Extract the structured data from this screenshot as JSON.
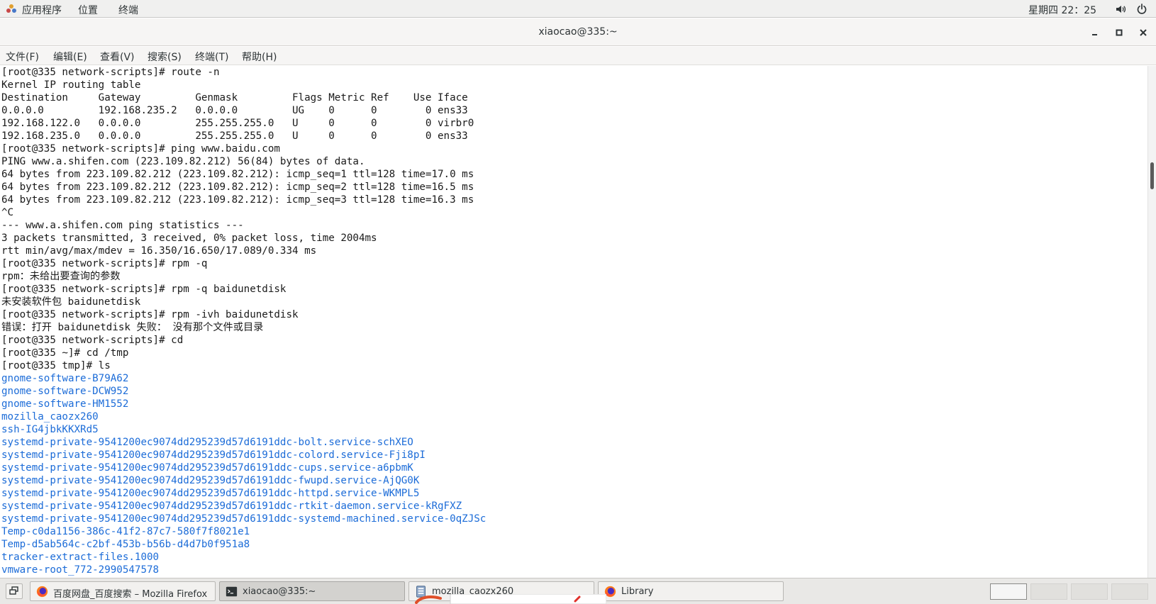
{
  "topbar": {
    "menus": [
      "应用程序",
      "位置",
      "终端"
    ],
    "clock": "星期四 22：25",
    "icons": [
      "volume-icon",
      "power-icon"
    ]
  },
  "window": {
    "title": "xiaocao@335:~",
    "controls": [
      "minimize-icon",
      "maximize-icon",
      "close-icon"
    ]
  },
  "menubar": {
    "items": [
      "文件(F)",
      "编辑(E)",
      "查看(V)",
      "搜索(S)",
      "终端(T)",
      "帮助(H)"
    ]
  },
  "terminal": {
    "lines": [
      {
        "text": "[root@335 network-scripts]# route -n",
        "type": "text"
      },
      {
        "text": "Kernel IP routing table",
        "type": "text"
      },
      {
        "text": "Destination     Gateway         Genmask         Flags Metric Ref    Use Iface",
        "type": "text"
      },
      {
        "text": "0.0.0.0         192.168.235.2   0.0.0.0         UG    0      0        0 ens33",
        "type": "text"
      },
      {
        "text": "192.168.122.0   0.0.0.0         255.255.255.0   U     0      0        0 virbr0",
        "type": "text"
      },
      {
        "text": "192.168.235.0   0.0.0.0         255.255.255.0   U     0      0        0 ens33",
        "type": "text"
      },
      {
        "text": "[root@335 network-scripts]# ping www.baidu.com",
        "type": "text"
      },
      {
        "text": "PING www.a.shifen.com (223.109.82.212) 56(84) bytes of data.",
        "type": "text"
      },
      {
        "text": "64 bytes from 223.109.82.212 (223.109.82.212): icmp_seq=1 ttl=128 time=17.0 ms",
        "type": "text"
      },
      {
        "text": "64 bytes from 223.109.82.212 (223.109.82.212): icmp_seq=2 ttl=128 time=16.5 ms",
        "type": "text"
      },
      {
        "text": "64 bytes from 223.109.82.212 (223.109.82.212): icmp_seq=3 ttl=128 time=16.3 ms",
        "type": "text"
      },
      {
        "text": "^C",
        "type": "text"
      },
      {
        "text": "--- www.a.shifen.com ping statistics ---",
        "type": "text"
      },
      {
        "text": "3 packets transmitted, 3 received, 0% packet loss, time 2004ms",
        "type": "text"
      },
      {
        "text": "rtt min/avg/max/mdev = 16.350/16.650/17.089/0.334 ms",
        "type": "text"
      },
      {
        "text": "[root@335 network-scripts]# rpm -q",
        "type": "text"
      },
      {
        "text": "rpm：未给出要查询的参数",
        "type": "text"
      },
      {
        "text": "[root@335 network-scripts]# rpm -q baidunetdisk",
        "type": "text"
      },
      {
        "text": "未安装软件包 baidunetdisk",
        "type": "text"
      },
      {
        "text": "[root@335 network-scripts]# rpm -ivh baidunetdisk",
        "type": "text"
      },
      {
        "text": "错误：打开 baidunetdisk 失败： 没有那个文件或目录",
        "type": "text"
      },
      {
        "text": "[root@335 network-scripts]# cd",
        "type": "text"
      },
      {
        "text": "[root@335 ~]# cd /tmp",
        "type": "text"
      },
      {
        "text": "[root@335 tmp]# ls",
        "type": "text"
      },
      {
        "text": "gnome-software-B79A62",
        "type": "dir"
      },
      {
        "text": "gnome-software-DCW952",
        "type": "dir"
      },
      {
        "text": "gnome-software-HM1552",
        "type": "dir"
      },
      {
        "text": "mozilla_caozx260",
        "type": "dir"
      },
      {
        "text": "ssh-IG4jbkKKXRd5",
        "type": "dir"
      },
      {
        "text": "systemd-private-9541200ec9074dd295239d57d6191ddc-bolt.service-schXEO",
        "type": "dir"
      },
      {
        "text": "systemd-private-9541200ec9074dd295239d57d6191ddc-colord.service-Fji8pI",
        "type": "dir"
      },
      {
        "text": "systemd-private-9541200ec9074dd295239d57d6191ddc-cups.service-a6pbmK",
        "type": "dir"
      },
      {
        "text": "systemd-private-9541200ec9074dd295239d57d6191ddc-fwupd.service-AjQG0K",
        "type": "dir"
      },
      {
        "text": "systemd-private-9541200ec9074dd295239d57d6191ddc-httpd.service-WKMPL5",
        "type": "dir"
      },
      {
        "text": "systemd-private-9541200ec9074dd295239d57d6191ddc-rtkit-daemon.service-kRgFXZ",
        "type": "dir"
      },
      {
        "text": "systemd-private-9541200ec9074dd295239d57d6191ddc-systemd-machined.service-0qZJSc",
        "type": "dir"
      },
      {
        "text": "Temp-c0da1156-386c-41f2-87c7-580f7f8021e1",
        "type": "dir"
      },
      {
        "text": "Temp-d5ab564c-c2bf-453b-b56b-d4d7b0f951a8",
        "type": "dir"
      },
      {
        "text": "tracker-extract-files.1000",
        "type": "dir"
      },
      {
        "text": "vmware-root_772-2990547578",
        "type": "dir"
      }
    ],
    "colors": {
      "text": "#1a1a1a",
      "directory": "#1c6cd8",
      "background": "#ffffff"
    }
  },
  "taskbar": {
    "show_desktop_icon": "show-desktop-icon",
    "tasks": [
      {
        "label": "百度网盘_百度搜索 – Mozilla Firefox",
        "icon": "firefox-icon",
        "active": false
      },
      {
        "label": "xiaocao@335:~",
        "icon": "terminal-icon",
        "active": true
      },
      {
        "label": "mozilla_caozx260",
        "icon": "file-manager-icon",
        "active": false
      },
      {
        "label": "Library",
        "icon": "firefox-icon",
        "active": false
      }
    ],
    "workspaces": 4,
    "current_workspace": 1
  }
}
